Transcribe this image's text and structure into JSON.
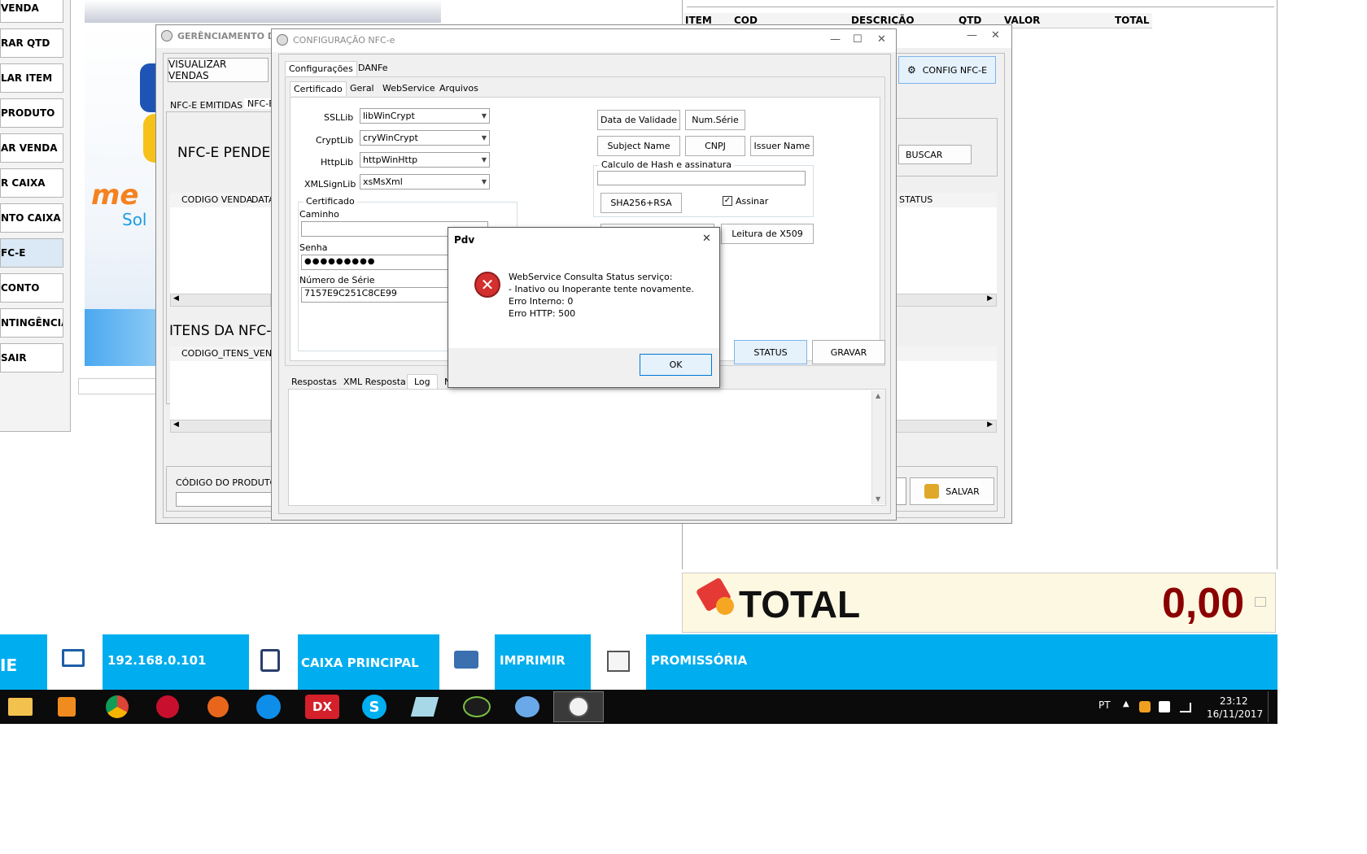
{
  "left_sidebar": {
    "items": [
      "VENDA",
      "RAR QTD",
      "LAR ITEM",
      " PRODUTO",
      "AR VENDA",
      "R CAIXA",
      "NTO CAIXA",
      "FC-E",
      "CONTO",
      "NTINGÊNCIA",
      "SAIR"
    ]
  },
  "sales_grid": {
    "headers": [
      "ITEM",
      "COD",
      "DESCRIÇÃO",
      "QTD",
      "VALOR",
      "TOTAL"
    ]
  },
  "total_panel": {
    "label": "TOTAL",
    "value": "0,00"
  },
  "bottom_bar": {
    "partial_label": "IE",
    "ip": "192.168.0.101",
    "caixa": "CAIXA PRINCIPAL",
    "imprimir": "IMPRIMIR",
    "promissoria": "PROMISSÓRIA"
  },
  "taskbar": {
    "lang": "PT",
    "time": "23:12",
    "date": "16/11/2017"
  },
  "gerenciamento": {
    "title": "GERÊNCIAMENTO DE",
    "visualizar_vendas": "VISUALIZAR VENDAS",
    "tabs": [
      "NFC-E EMITIDAS",
      "NFC-E"
    ],
    "pendentes_label": "NFC-E PENDEN",
    "grid1_headers": [
      "CODIGO VENDA",
      "DATA"
    ],
    "itens_label": "ITENS DA NFC-E",
    "grid2_headers": [
      "CODIGO_ITENS_VENDA"
    ],
    "codigo_produto": "CÓDIGO DO PRODUTO",
    "config_nfce": "CONFIG NFC-E",
    "buscar": "BUSCAR",
    "status_header": "STATUS",
    "salvar": "SALVAR"
  },
  "config": {
    "title": "CONFIGURAÇÃO NFC-e",
    "top_tabs": [
      "Configurações",
      "DANFe"
    ],
    "sub_tabs": [
      "Certificado",
      "Geral",
      "WebService",
      "Arquivos"
    ],
    "ssllib_label": "SSLLib",
    "ssllib": "libWinCrypt",
    "cryptlib_label": "CryptLib",
    "cryptlib": "cryWinCrypt",
    "httplib_label": "HttpLib",
    "httplib": "httpWinHttp",
    "xmlsignlib_label": "XMLSignLib",
    "xmlsignlib": "xsMsXml",
    "certificado_group": "Certificado",
    "caminho_label": "Caminho",
    "senha_label": "Senha",
    "senha_value": "●●●●●●●●●",
    "numero_serie_label": "Número de Série",
    "numero_serie_value": "7157E9C251C8CE99",
    "data_validade": "Data de Validade",
    "num_serie_btn": "Num.Série",
    "subject_name": "Subject Name",
    "cnpj": "CNPJ",
    "issuer_name": "Issuer Name",
    "hash_group": "Calculo de Hash e assinatura",
    "sha_btn": "SHA256+RSA",
    "assinar": "Assinar",
    "leitura_x509": "Leitura de X509",
    "status_btn": "STATUS",
    "gravar_btn": "GRAVAR",
    "response_tabs": [
      "Respostas",
      "XML Resposta",
      "Log",
      "N"
    ]
  },
  "dialog": {
    "title": "Pdv",
    "line1": "WebService Consulta Status serviço:",
    "line2": "- Inativo ou Inoperante tente novamente.",
    "line3": "Erro Interno: 0",
    "line4": "Erro HTTP: 500",
    "ok": "OK"
  },
  "colors": {
    "blue_bar": "#00aeef",
    "total_bg": "#fdf8e1",
    "total_value": "#8b0000"
  }
}
